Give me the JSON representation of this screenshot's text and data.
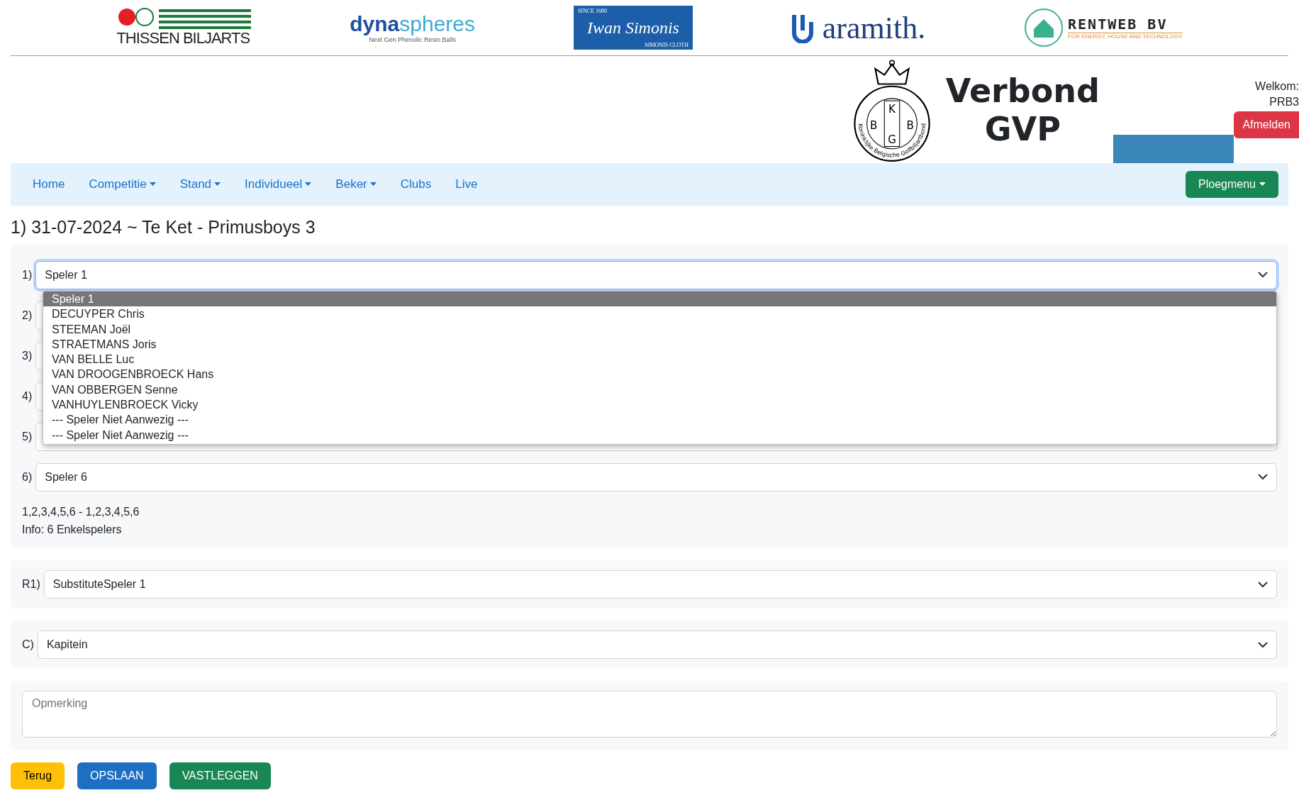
{
  "sponsors": [
    {
      "kind": "thissen",
      "text": "THISSEN",
      "text2": "BILJARTS"
    },
    {
      "kind": "dyna",
      "text": "dyna",
      "text2": "spheres",
      "tagline": "Next Gen Phenolic Resin Balls"
    },
    {
      "kind": "simonis",
      "text": "SINCE 1680",
      "text2": "Iwan Simonis",
      "tagline": "SIMONIS CLOTH"
    },
    {
      "kind": "aramith",
      "text": "aramith",
      "text2": "."
    },
    {
      "kind": "rentweb",
      "text": "RENTWEB BV",
      "tagline": "FOR ENERGY, HOUSE AND TECHNOLOGY"
    }
  ],
  "header": {
    "crest_letters": [
      "K",
      "B",
      "B",
      "G"
    ],
    "crest_ring": "Koninklijke Belgische Golfbiljartbond",
    "title_line1": "Verbond",
    "title_line2": "GVP",
    "welcome": "Welkom:",
    "user": "PRB3",
    "logout": "Afmelden"
  },
  "nav": {
    "items": [
      {
        "label": "Home",
        "has_menu": false
      },
      {
        "label": "Competitie",
        "has_menu": true
      },
      {
        "label": "Stand",
        "has_menu": true
      },
      {
        "label": "Individueel",
        "has_menu": true
      },
      {
        "label": "Beker",
        "has_menu": true
      },
      {
        "label": "Clubs",
        "has_menu": false
      },
      {
        "label": "Live",
        "has_menu": false
      }
    ],
    "team_menu": "Ploegmenu"
  },
  "page_title": "1) 31-07-2024 ~ Te Ket - Primusboys 3",
  "players": [
    {
      "label": "1)",
      "value": "Speler 1",
      "open": true,
      "options": [
        {
          "label": "Speler 1",
          "selected": true
        },
        {
          "label": "DECUYPER Chris",
          "selected": false
        },
        {
          "label": "STEEMAN Joël",
          "selected": false
        },
        {
          "label": "STRAETMANS Joris",
          "selected": false
        },
        {
          "label": "VAN BELLE Luc",
          "selected": false
        },
        {
          "label": "VAN DROOGENBROECK Hans",
          "selected": false
        },
        {
          "label": "VAN OBBERGEN Senne",
          "selected": false
        },
        {
          "label": "VANHUYLENBROECK Vicky",
          "selected": false
        },
        {
          "label": "--- Speler Niet Aanwezig ---",
          "selected": false
        },
        {
          "label": "--- Speler Niet Aanwezig ---",
          "selected": false
        }
      ]
    },
    {
      "label": "2)",
      "open": false
    },
    {
      "label": "3)",
      "open": false
    },
    {
      "label": "4)",
      "open": false
    },
    {
      "label": "5)",
      "open": false
    },
    {
      "label": "6)",
      "value": "Speler 6",
      "open": false
    }
  ],
  "order_text": "1,2,3,4,5,6 - 1,2,3,4,5,6",
  "info_text": "Info: 6 Enkelspelers",
  "substitute": {
    "label": "R1)",
    "value": "SubstituteSpeler 1"
  },
  "captain": {
    "label": "C)",
    "value": "Kapitein"
  },
  "remark": {
    "placeholder": "Opmerking"
  },
  "actions": [
    {
      "kind": "warning",
      "label": "Terug"
    },
    {
      "kind": "primary",
      "label": "OPSLAAN"
    },
    {
      "kind": "success",
      "label": "VASTLEGGEN"
    }
  ]
}
